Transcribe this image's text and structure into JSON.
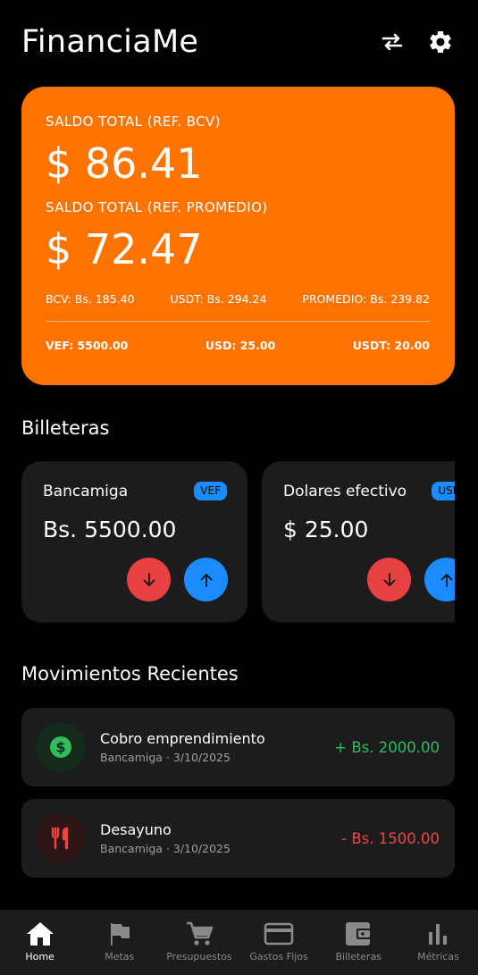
{
  "app": {
    "title": "FinanciaMe"
  },
  "balance": {
    "label_bcv": "SALDO TOTAL (REF. BCV)",
    "amount_bcv": "$ 86.41",
    "label_promedio": "SALDO TOTAL (REF. PROMEDIO)",
    "amount_promedio": "$ 72.47",
    "rates": [
      "BCV: Bs. 185.40",
      "USDT: Bs. 294.24",
      "PROMEDIO: Bs. 239.82"
    ],
    "holdings": [
      "VEF: 5500.00",
      "USD: 25.00",
      "USDT: 20.00"
    ]
  },
  "wallets": {
    "title": "Billeteras",
    "items": [
      {
        "name": "Bancamiga",
        "currency": "VEF",
        "balance": "Bs. 5500.00"
      },
      {
        "name": "Dolares efectivo",
        "currency": "USD",
        "balance": "$ 25.00"
      }
    ]
  },
  "movements": {
    "title": "Movimientos Recientes",
    "items": [
      {
        "title": "Cobro emprendimiento",
        "meta": "Bancamiga · 3/10/2025",
        "amount": "+ Bs. 2000.00",
        "icon": "dollar-circle-icon",
        "color": "#2ebd59"
      },
      {
        "title": "Desayuno",
        "meta": "Bancamiga · 3/10/2025",
        "amount": "- Bs. 1500.00",
        "icon": "restaurant-icon",
        "color": "#ef4444"
      }
    ]
  },
  "nav": {
    "items": [
      {
        "label": "Home",
        "icon": "home-icon",
        "active": true
      },
      {
        "label": "Metas",
        "icon": "flag-icon"
      },
      {
        "label": "Presupuestos",
        "icon": "cart-icon"
      },
      {
        "label": "Gastos Fijos",
        "icon": "credit-card-icon"
      },
      {
        "label": "Billeteras",
        "icon": "wallet-icon"
      },
      {
        "label": "Métricas",
        "icon": "bar-chart-icon"
      }
    ]
  },
  "colors": {
    "accent": "#ff7300",
    "income": "#2ebd59",
    "expense": "#ef4444",
    "primary_blue": "#1a8cff"
  }
}
